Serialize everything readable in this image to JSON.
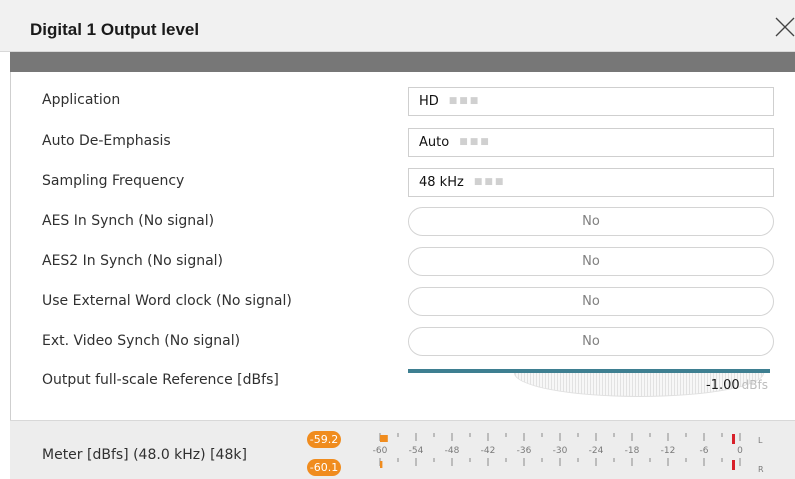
{
  "window": {
    "title": "Digital 1 Output level"
  },
  "settings": {
    "application": {
      "label": "Application",
      "value": "HD"
    },
    "auto_deemphasis": {
      "label": "Auto De-Emphasis",
      "value": "Auto"
    },
    "sampling_frequency": {
      "label": "Sampling Frequency",
      "value": "48 kHz"
    },
    "aes_in_synch": {
      "label": "AES In Synch (No signal)",
      "value": "No"
    },
    "aes2_in_synch": {
      "label": "AES2 In Synch (No signal)",
      "value": "No"
    },
    "external_word_clock": {
      "label": "Use External Word clock (No signal)",
      "value": "No"
    },
    "ext_video_synch": {
      "label": "Ext. Video Synch (No signal)",
      "value": "No"
    },
    "output_reference": {
      "label": "Output full-scale Reference [dBfs]",
      "value": "-1.00",
      "unit": "dBfs",
      "range_min": -60,
      "range_max": 0
    }
  },
  "meter": {
    "label": "Meter [dBfs] (48.0 kHz) [48k]",
    "peak_left": "-59.2",
    "peak_right": "-60.1",
    "scale": [
      "-60",
      "-54",
      "-48",
      "-42",
      "-36",
      "-30",
      "-24",
      "-18",
      "-12",
      "-6",
      "0"
    ],
    "channel_left": "L",
    "channel_right": "R",
    "level_left_db": -59.2,
    "level_right_db": -60.1,
    "colors": {
      "peak": "#f08c1e",
      "clip_marker": "#d8202a",
      "tick": "#8a8a8a"
    }
  },
  "colors": {
    "slider_track": "#3e7f91",
    "header_strip": "#777777"
  }
}
